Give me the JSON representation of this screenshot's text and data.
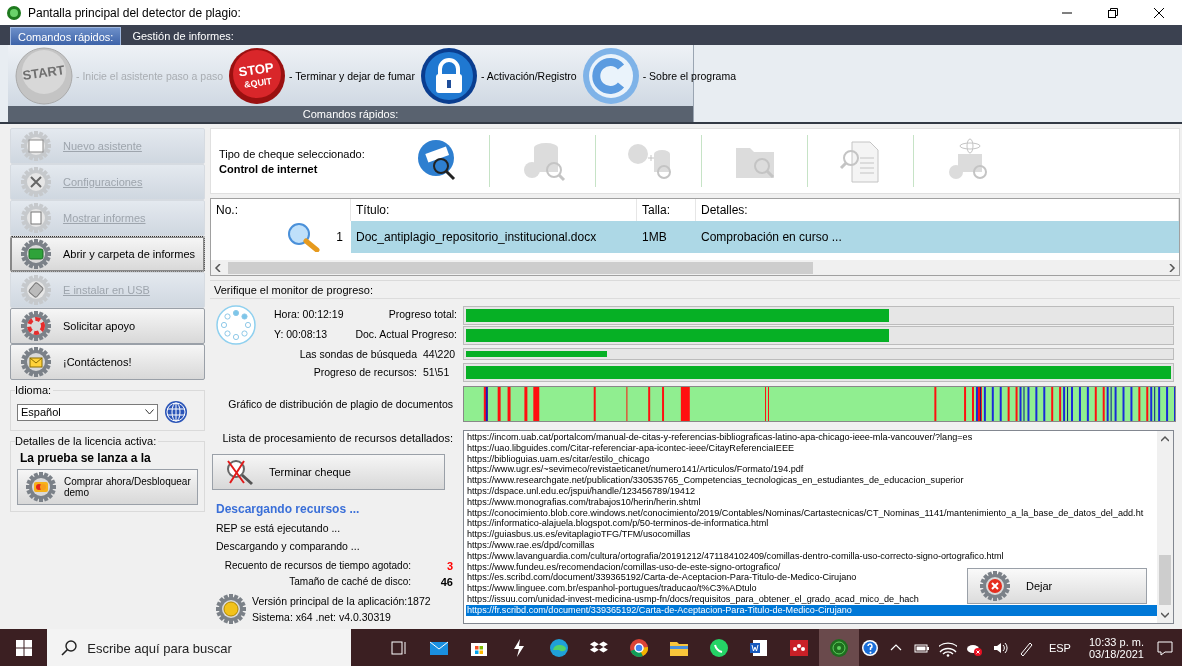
{
  "window": {
    "title": "Pantalla principal del detector de plagio:"
  },
  "ribbon": {
    "tabs": [
      {
        "label": "Comandos rápidos:",
        "selected": true
      },
      {
        "label": "Gestión de informes:",
        "selected": false
      }
    ],
    "commands": [
      {
        "kind": "start",
        "badge": [
          "START"
        ],
        "label": "- Inicie el asistente paso a paso",
        "disabled": true
      },
      {
        "kind": "stop",
        "badge": [
          "STOP",
          "&QUIT"
        ],
        "label": "- Terminar y dejar de fumar",
        "disabled": false
      },
      {
        "kind": "lock",
        "label": "- Activación/Registro",
        "disabled": false
      },
      {
        "kind": "copyright",
        "label": "- Sobre el programa",
        "disabled": false
      }
    ],
    "group_label": "Comandos rápidos:"
  },
  "sidebar": {
    "buttons": [
      {
        "kind": "wizard",
        "label": "Nuevo asistente",
        "disabled": true,
        "focused": false
      },
      {
        "kind": "tools",
        "label": "Configuraciones",
        "disabled": true,
        "focused": false
      },
      {
        "kind": "report",
        "label": "Mostrar informes",
        "disabled": true,
        "focused": false
      },
      {
        "kind": "folder",
        "label": "Abrir y carpeta de informes",
        "disabled": false,
        "focused": true
      },
      {
        "kind": "usb",
        "label": "E instalar en USB",
        "disabled": true,
        "focused": false
      },
      {
        "kind": "lifebuoy",
        "label": "Solicitar apoyo",
        "disabled": false,
        "focused": false
      },
      {
        "kind": "mail",
        "label": "¡Contáctenos!",
        "disabled": false,
        "focused": false
      }
    ],
    "language": {
      "label": "Idioma:",
      "value": "Español"
    },
    "license": {
      "label": "Detalles de la licencia activa:",
      "status": "La prueba se lanza a la",
      "button": "Comprar ahora/Desbloquear demo"
    }
  },
  "check_type": {
    "label": "Tipo de cheque seleccionado:",
    "value": "Control de internet",
    "types": [
      {
        "kind": "internet",
        "selected": true
      },
      {
        "kind": "database",
        "selected": false
      },
      {
        "kind": "internet-database",
        "selected": false
      },
      {
        "kind": "folder",
        "selected": false
      },
      {
        "kind": "document",
        "selected": false
      },
      {
        "kind": "atom-database",
        "selected": false
      }
    ]
  },
  "table": {
    "columns": [
      "No.:",
      "Título:",
      "Talla:",
      "Detalles:"
    ],
    "rows": [
      {
        "no": "1",
        "title": "Doc_antiplagio_repositorio_institucional.docx",
        "size": "1MB",
        "details": "Comprobación en curso ...",
        "selected": true
      }
    ]
  },
  "progress": {
    "label": "Verifique el monitor de progreso:",
    "time": "Hora: 00:12:19",
    "elapsed": "Y: 00:08:13",
    "bars": [
      {
        "label": "Progreso total:",
        "level": 0.6
      },
      {
        "label": "Doc. Actual Progreso:",
        "level": 0.6
      },
      {
        "label": "Las sondas de búsqueda",
        "count": "44\\220",
        "level": 0.2
      },
      {
        "label": "Progreso de recursos:",
        "count": "51\\51",
        "level": 1
      }
    ],
    "distribution_label": "Gráfico de distribución de plagio de documentos",
    "list_label": "Lista de procesamiento de recursos detallados:",
    "terminate_button": "Terminar cheque",
    "status_title": "Descargando recursos ...",
    "status_lines": [
      "REP se está ejecutando ...",
      "Descargando y comparando ..."
    ],
    "counters": [
      {
        "label": "Recuento de recursos de tiempo agotado:",
        "value": "3",
        "color": "#ff0000"
      },
      {
        "label": "Tamaño de caché de disco:",
        "value": "46",
        "color": "#000000"
      }
    ],
    "version": [
      "Versión principal de la aplicación:1872",
      "Sistema: x64 .net: v4.0.30319"
    ],
    "resources": [
      {
        "url": "https://incom.uab.cat/portalcom/manual-de-citas-y-referencias-bibliograficas-latino-apa-chicago-ieee-mla-vancouver/?lang=es",
        "selected": false
      },
      {
        "url": "https://uao.libguides.com/Citar-referenciar-apa-icontec-ieee/CitayReferenciaIEEE",
        "selected": false
      },
      {
        "url": "https://biblioguias.uam.es/citar/estilo_chicago",
        "selected": false
      },
      {
        "url": "https://www.ugr.es/~sevimeco/revistaeticanet/numero141/Articulos/Formato/194.pdf",
        "selected": false
      },
      {
        "url": "https://www.researchgate.net/publication/330535765_Competencias_tecnologicas_en_estudiantes_de_educacion_superior",
        "selected": false
      },
      {
        "url": "https://dspace.unl.edu.ec/jspui/handle/123456789/19412",
        "selected": false
      },
      {
        "url": "https://www.monografias.com/trabajos10/herin/herin.shtml",
        "selected": false
      },
      {
        "url": "https://conocimiento.blob.core.windows.net/conocimiento/2019/Contables/Nominas/Cartastecnicas/CT_Nominas_1141/mantenimiento_a_la_base_de_datos_del_add.ht",
        "selected": false
      },
      {
        "url": "https://informatico-alajuela.blogspot.com/p/50-terminos-de-informatica.html",
        "selected": false
      },
      {
        "url": "https://guiasbus.us.es/evitaplagioTFG/TFM/usocomillas",
        "selected": false
      },
      {
        "url": "https://www.rae.es/dpd/comillas",
        "selected": false
      },
      {
        "url": "https://www.lavanguardia.com/cultura/ortografia/20191212/471184102409/comillas-dentro-comilla-uso-correcto-signo-ortografico.html",
        "selected": false
      },
      {
        "url": "https://www.fundeu.es/recomendacion/comillas-uso-de-este-signo-ortografico/",
        "selected": false
      },
      {
        "url": "https://es.scribd.com/document/339365192/Carta-de-Aceptacion-Para-Titulo-de-Medico-Cirujano",
        "selected": false
      },
      {
        "url": "https://www.linguee.com.br/espanhol-portugues/traducao/t%C3%ADtulo",
        "selected": false
      },
      {
        "url": "https://issuu.com/unidad-invest-medicina-usmp-fn/docs/requisitos_para_obtener_el_grado_acad_mico_de_hach",
        "selected": false
      },
      {
        "url": "https://fr.scribd.com/document/339365192/Carta-de-Aceptacion-Para-Titulo-de-Medico-Cirujano",
        "selected": true
      }
    ],
    "quit_button": "Dejar"
  },
  "taskbar": {
    "search_placeholder": "Escribe aquí para buscar",
    "apps": [
      {
        "kind": "task-view",
        "active": false
      },
      {
        "kind": "mail",
        "active": false
      },
      {
        "kind": "store",
        "active": false
      },
      {
        "kind": "bolt",
        "active": false
      },
      {
        "kind": "edge",
        "active": false
      },
      {
        "kind": "dropbox",
        "active": false
      },
      {
        "kind": "chrome",
        "active": false
      },
      {
        "kind": "folder",
        "active": false
      },
      {
        "kind": "whatsapp",
        "active": false
      },
      {
        "kind": "word",
        "active": false
      },
      {
        "kind": "mendeley",
        "active": false
      },
      {
        "kind": "plagiarism",
        "active": true
      }
    ],
    "language": "ESP",
    "time": "10:33 p. m.",
    "date": "03/18/2021"
  }
}
